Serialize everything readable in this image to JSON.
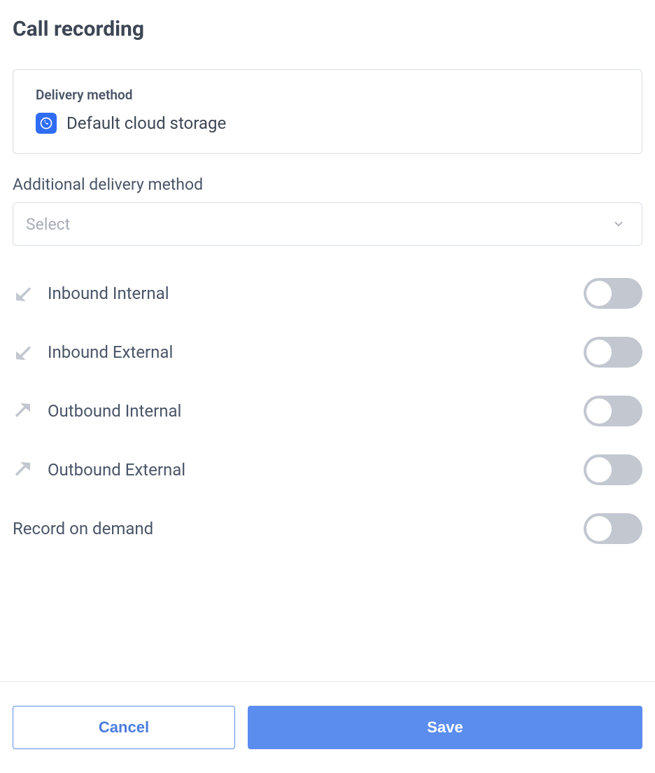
{
  "page": {
    "title": "Call recording"
  },
  "delivery": {
    "label": "Delivery method",
    "value": "Default cloud storage"
  },
  "additional": {
    "label": "Additional delivery method",
    "placeholder": "Select"
  },
  "toggles": {
    "inbound_internal": {
      "label": "Inbound Internal",
      "on": false
    },
    "inbound_external": {
      "label": "Inbound External",
      "on": false
    },
    "outbound_internal": {
      "label": "Outbound Internal",
      "on": false
    },
    "outbound_external": {
      "label": "Outbound External",
      "on": false
    },
    "record_on_demand": {
      "label": "Record on demand",
      "on": false
    }
  },
  "footer": {
    "cancel": "Cancel",
    "save": "Save"
  }
}
